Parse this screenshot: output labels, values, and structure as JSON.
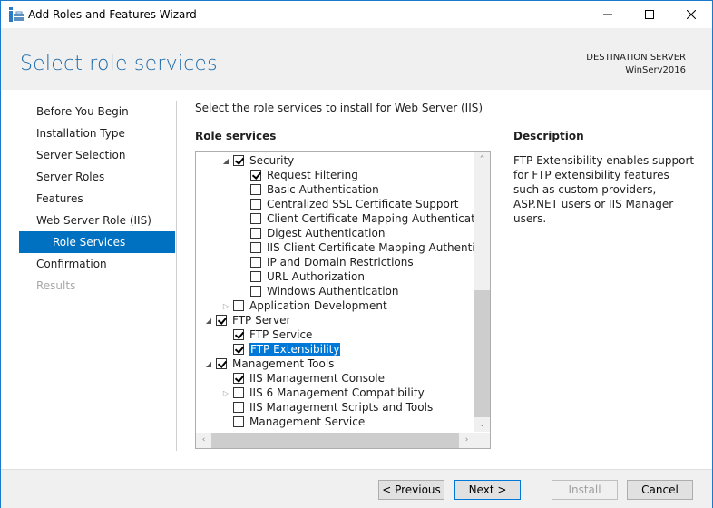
{
  "window": {
    "title": "Add Roles and Features Wizard",
    "controls": {
      "minimize": "minimize",
      "maximize": "maximize",
      "close": "close"
    }
  },
  "header": {
    "page_title": "Select role services",
    "destination_label": "DESTINATION SERVER",
    "destination_server": "WinServ2016"
  },
  "nav": {
    "items": [
      {
        "label": "Before You Begin",
        "state": "normal"
      },
      {
        "label": "Installation Type",
        "state": "normal"
      },
      {
        "label": "Server Selection",
        "state": "normal"
      },
      {
        "label": "Server Roles",
        "state": "normal"
      },
      {
        "label": "Features",
        "state": "normal"
      },
      {
        "label": "Web Server Role (IIS)",
        "state": "normal"
      },
      {
        "label": "Role Services",
        "state": "active"
      },
      {
        "label": "Confirmation",
        "state": "normal"
      },
      {
        "label": "Results",
        "state": "disabled"
      }
    ]
  },
  "main": {
    "intro": "Select the role services to install for Web Server (IIS)",
    "role_services_label": "Role services",
    "tree": [
      {
        "label": "Security",
        "level": 1,
        "expander": "expanded",
        "checked": true
      },
      {
        "label": "Request Filtering",
        "level": 2,
        "expander": "none",
        "checked": true
      },
      {
        "label": "Basic Authentication",
        "level": 2,
        "expander": "none",
        "checked": false
      },
      {
        "label": "Centralized SSL Certificate Support",
        "level": 2,
        "expander": "none",
        "checked": false
      },
      {
        "label": "Client Certificate Mapping Authentication",
        "level": 2,
        "expander": "none",
        "checked": false
      },
      {
        "label": "Digest Authentication",
        "level": 2,
        "expander": "none",
        "checked": false
      },
      {
        "label": "IIS Client Certificate Mapping Authentication",
        "level": 2,
        "expander": "none",
        "checked": false
      },
      {
        "label": "IP and Domain Restrictions",
        "level": 2,
        "expander": "none",
        "checked": false
      },
      {
        "label": "URL Authorization",
        "level": 2,
        "expander": "none",
        "checked": false
      },
      {
        "label": "Windows Authentication",
        "level": 2,
        "expander": "none",
        "checked": false
      },
      {
        "label": "Application Development",
        "level": 1,
        "expander": "collapsed",
        "checked": false
      },
      {
        "label": "FTP Server",
        "level": 0,
        "expander": "expanded",
        "checked": true
      },
      {
        "label": "FTP Service",
        "level": 1,
        "expander": "none",
        "checked": true
      },
      {
        "label": "FTP Extensibility",
        "level": 1,
        "expander": "none",
        "checked": true,
        "selected": true
      },
      {
        "label": "Management Tools",
        "level": 0,
        "expander": "expanded",
        "checked": true
      },
      {
        "label": "IIS Management Console",
        "level": 1,
        "expander": "none",
        "checked": true
      },
      {
        "label": "IIS 6 Management Compatibility",
        "level": 1,
        "expander": "collapsed",
        "checked": false
      },
      {
        "label": "IIS Management Scripts and Tools",
        "level": 1,
        "expander": "none",
        "checked": false
      },
      {
        "label": "Management Service",
        "level": 1,
        "expander": "none",
        "checked": false
      }
    ],
    "description_label": "Description",
    "description_text": "FTP Extensibility enables support for FTP extensibility features such as custom providers, ASP.NET users or IIS Manager users."
  },
  "footer": {
    "previous": "< Previous",
    "next": "Next >",
    "install": "Install",
    "cancel": "Cancel"
  },
  "colors": {
    "accent": "#0070c0",
    "title_blue": "#1e6bab",
    "selection": "#0078d7"
  }
}
